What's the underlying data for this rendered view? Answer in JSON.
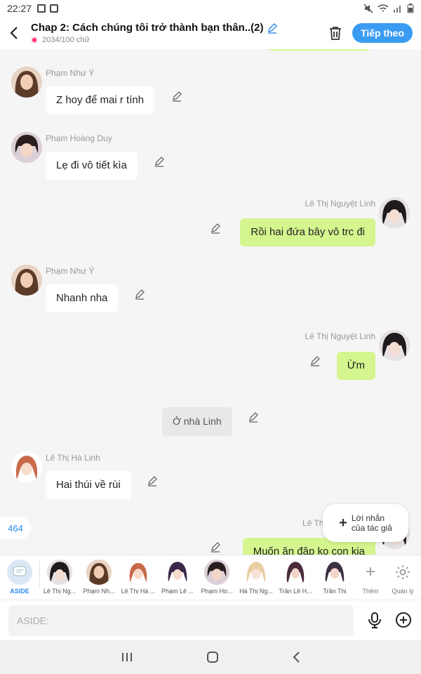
{
  "status": {
    "time": "22:27"
  },
  "header": {
    "title": "Chap 2: Cách chúng tôi trở thành bạn thân..(2)",
    "word_count": "2034/100 chữ",
    "next_label": "Tiếp theo"
  },
  "messages": [
    {
      "name": "Phạm Như Ý",
      "text": "Z hoy để mai r tính"
    },
    {
      "name": "Phạm Hoàng Duy",
      "text": "Lẹ đi vô tiết kìa"
    },
    {
      "name": "Lê Thị Nguyệt Linh",
      "text": "Rồi hai đứa bây vô trc đi"
    },
    {
      "name": "Phạm Như Ý",
      "text": "Nhanh nha"
    },
    {
      "name": "Lê Thị Nguyệt Linh",
      "text": "Ừm"
    },
    {
      "name": "",
      "text": "Ở nhà Linh"
    },
    {
      "name": "Lê Thị Hà Linh",
      "text": "Hai thúi về rùi"
    },
    {
      "name": "Lê Th",
      "text": "Muốn ăn đập ko con kia"
    }
  ],
  "fab": {
    "line1": "Lời nhắn",
    "line2": "của tác giả"
  },
  "counter": "464",
  "characters": [
    {
      "label": "ASIDE"
    },
    {
      "label": "Lê Thị Ng..."
    },
    {
      "label": "Phạm Nh..."
    },
    {
      "label": "Lê Thị Hà ..."
    },
    {
      "label": "Phạm Lê ..."
    },
    {
      "label": "Phạm Ho..."
    },
    {
      "label": "Hà Thị Ng..."
    },
    {
      "label": "Trần Lê H..."
    },
    {
      "label": "Trần Thị"
    }
  ],
  "tools": {
    "add_label": "Thêm",
    "manage_label": "Quản lý"
  },
  "input": {
    "placeholder": "ASIDE:"
  },
  "colors": {
    "accent": "#3a9bf2",
    "my_bubble": "#d5f58e"
  }
}
